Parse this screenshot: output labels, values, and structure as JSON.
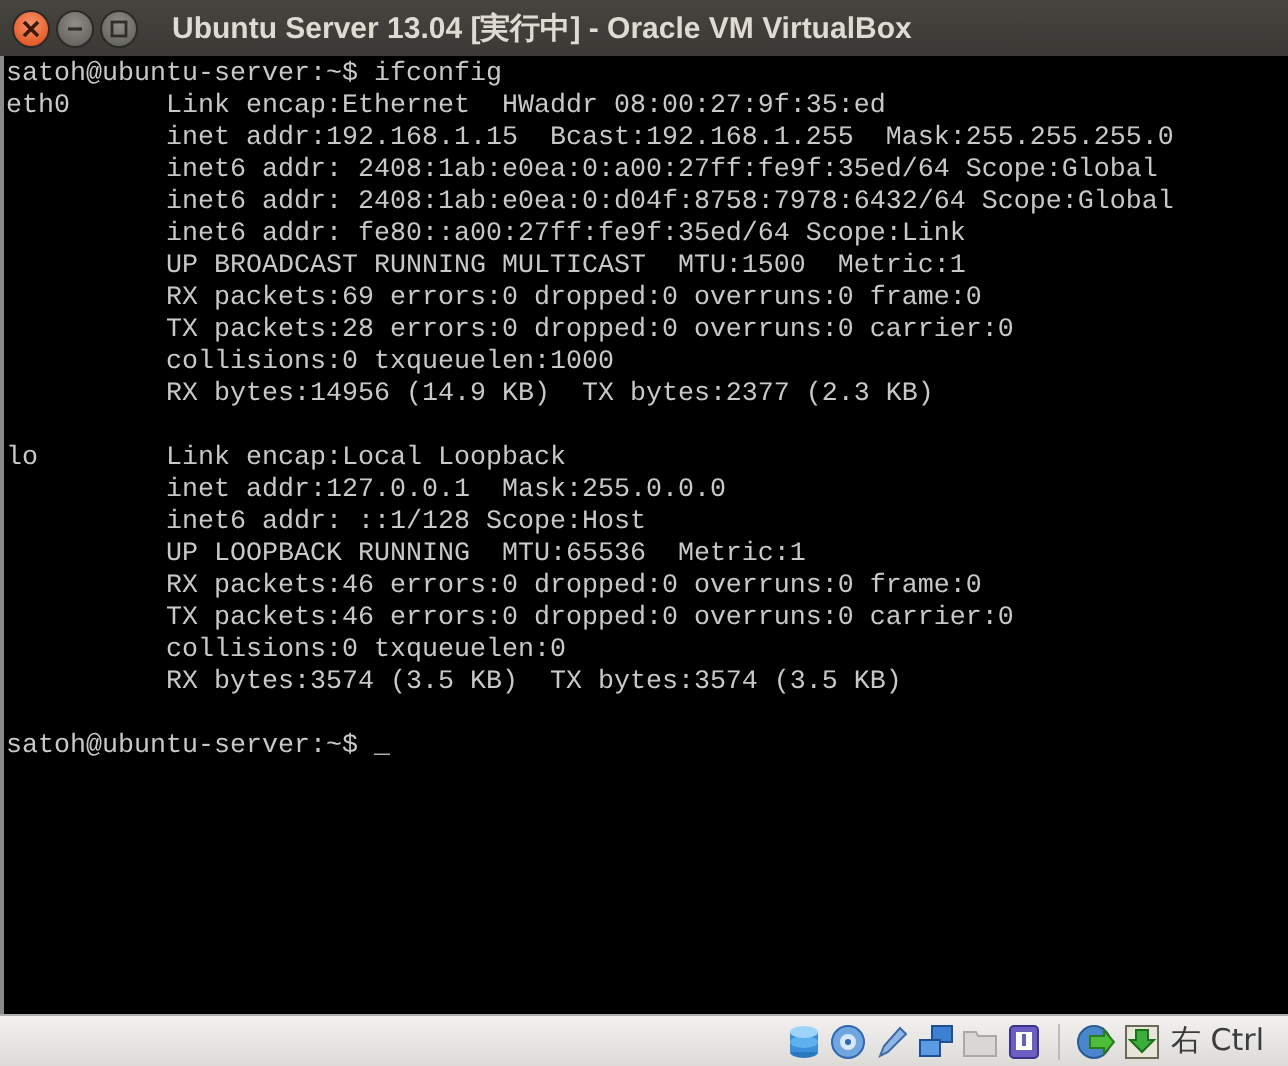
{
  "window": {
    "title": "Ubuntu Server 13.04 [実行中] - Oracle VM VirtualBox"
  },
  "terminal": {
    "blocks": [
      {
        "kind": "command",
        "prompt": "satoh@ubuntu-server:~$",
        "input": "ifconfig"
      },
      {
        "kind": "interface",
        "name": "eth0",
        "lines": [
          "Link encap:Ethernet  HWaddr 08:00:27:9f:35:ed",
          "inet addr:192.168.1.15  Bcast:192.168.1.255  Mask:255.255.255.0",
          "inet6 addr: 2408:1ab:e0ea:0:a00:27ff:fe9f:35ed/64 Scope:Global",
          "inet6 addr: 2408:1ab:e0ea:0:d04f:8758:7978:6432/64 Scope:Global",
          "inet6 addr: fe80::a00:27ff:fe9f:35ed/64 Scope:Link",
          "UP BROADCAST RUNNING MULTICAST  MTU:1500  Metric:1",
          "RX packets:69 errors:0 dropped:0 overruns:0 frame:0",
          "TX packets:28 errors:0 dropped:0 overruns:0 carrier:0",
          "collisions:0 txqueuelen:1000",
          "RX bytes:14956 (14.9 KB)  TX bytes:2377 (2.3 KB)"
        ]
      },
      {
        "kind": "interface",
        "name": "lo",
        "lines": [
          "Link encap:Local Loopback",
          "inet addr:127.0.0.1  Mask:255.0.0.0",
          "inet6 addr: ::1/128 Scope:Host",
          "UP LOOPBACK RUNNING  MTU:65536  Metric:1",
          "RX packets:46 errors:0 dropped:0 overruns:0 frame:0",
          "TX packets:46 errors:0 dropped:0 overruns:0 carrier:0",
          "collisions:0 txqueuelen:0",
          "RX bytes:3574 (3.5 KB)  TX bytes:3574 (3.5 KB)"
        ]
      },
      {
        "kind": "command",
        "prompt": "satoh@ubuntu-server:~$",
        "cursor": "_"
      }
    ]
  },
  "status_bar": {
    "host_key": "右 Ctrl"
  }
}
